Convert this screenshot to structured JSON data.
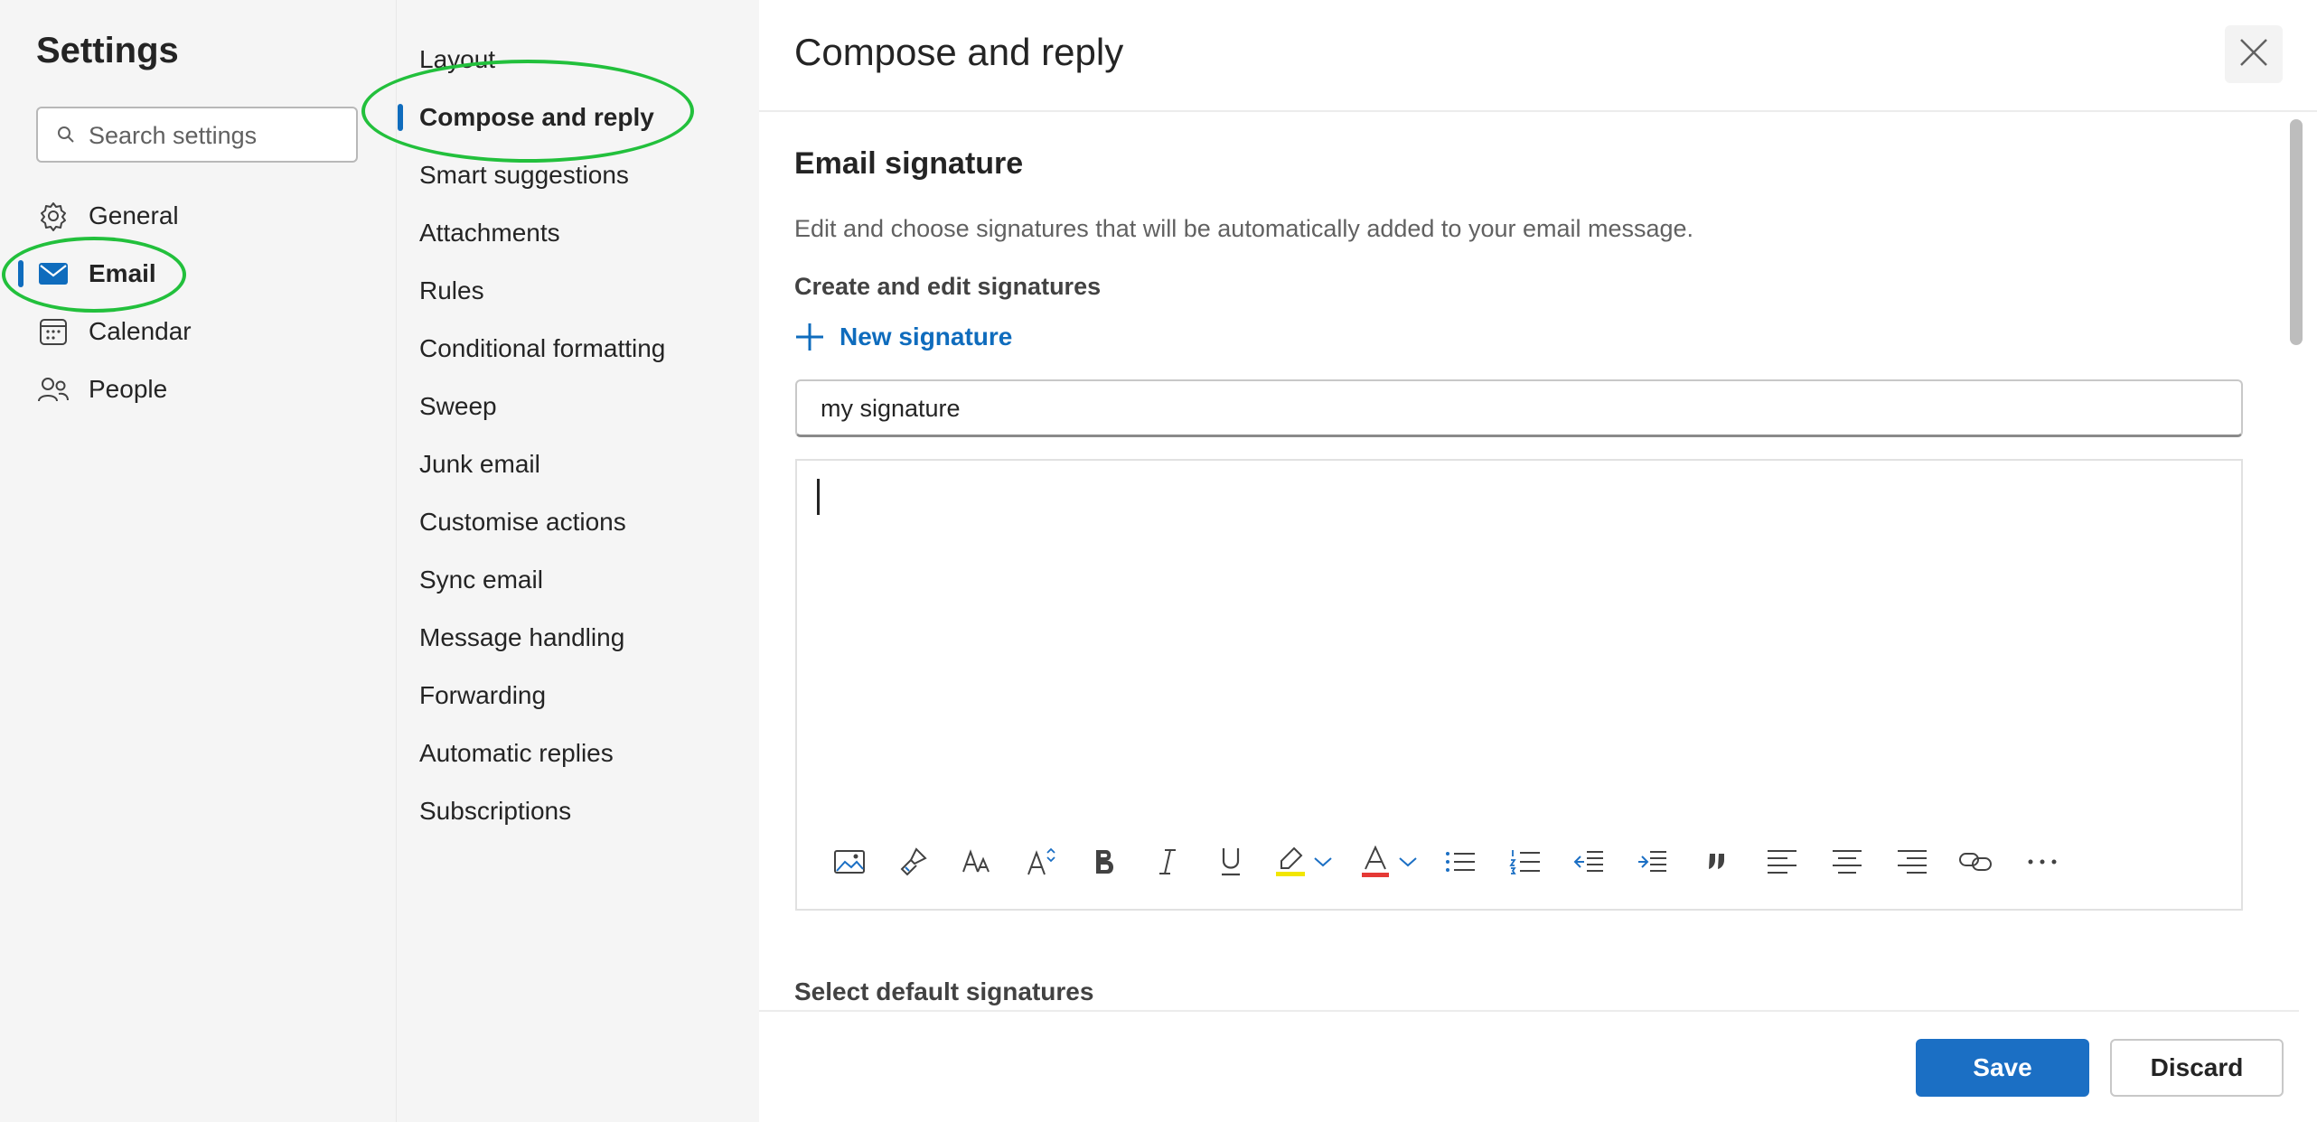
{
  "settings": {
    "title": "Settings",
    "search_placeholder": "Search settings",
    "nav": [
      {
        "label": "General",
        "icon": "gear-icon"
      },
      {
        "label": "Email",
        "icon": "mail-icon",
        "selected": true
      },
      {
        "label": "Calendar",
        "icon": "calendar-icon"
      },
      {
        "label": "People",
        "icon": "people-icon"
      }
    ]
  },
  "subnav": [
    {
      "label": "Layout"
    },
    {
      "label": "Compose and reply",
      "selected": true
    },
    {
      "label": "Smart suggestions"
    },
    {
      "label": "Attachments"
    },
    {
      "label": "Rules"
    },
    {
      "label": "Conditional formatting"
    },
    {
      "label": "Sweep"
    },
    {
      "label": "Junk email"
    },
    {
      "label": "Customise actions"
    },
    {
      "label": "Sync email"
    },
    {
      "label": "Message handling"
    },
    {
      "label": "Forwarding"
    },
    {
      "label": "Automatic replies"
    },
    {
      "label": "Subscriptions"
    }
  ],
  "main": {
    "title": "Compose and reply",
    "section_title": "Email signature",
    "description": "Edit and choose signatures that will be automatically added to your email message.",
    "create_heading": "Create and edit signatures",
    "new_signature_label": "New signature",
    "signature_name_value": "my signature",
    "select_default_heading": "Select default signatures",
    "toolbar_icons": [
      "insert-picture-icon",
      "format-painter-icon",
      "font-icon",
      "font-size-icon",
      "bold-icon",
      "italic-icon",
      "underline-icon",
      "highlight-icon",
      "font-color-icon",
      "bullets-icon",
      "numbering-icon",
      "decrease-indent-icon",
      "increase-indent-icon",
      "quote-icon",
      "align-left-icon",
      "align-center-icon",
      "align-right-icon",
      "link-icon",
      "more-options-icon"
    ]
  },
  "footer": {
    "save_label": "Save",
    "discard_label": "Discard"
  },
  "colors": {
    "accent": "#0f6cbd",
    "save_button": "#1b6fc4",
    "annotation_circle": "#22c03c",
    "highlight_yellow": "#f2e600",
    "font_color_red": "#e53935"
  }
}
